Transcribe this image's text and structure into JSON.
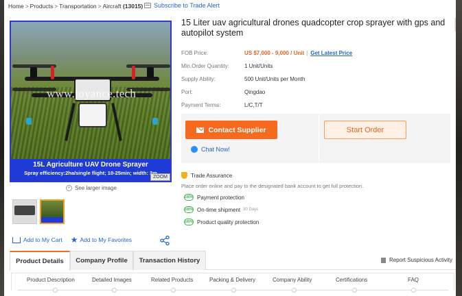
{
  "breadcrumb": {
    "items": [
      "Home",
      "Products",
      "Transportation",
      "Aircraft"
    ],
    "count": "(13015)"
  },
  "subscribe_label": "Subscribe to Trade Alert",
  "product": {
    "title": "15 Liter uav agricultural drones quadcopter crop sprayer with gps and autopilot system",
    "image_watermark": "www.joyance.tech",
    "image_caption_title": "15L Agriculture UAV Drone Sprayer",
    "image_caption_sub": "Spray efficiency:2ha/single flight; 10-25min; width: 3m",
    "zoom_label": "ZOOM",
    "see_larger": "See larger image"
  },
  "specs": {
    "fob_label": "FOB Price:",
    "fob_value": "US $7,000 - 9,000 / Unit",
    "latest_price": "Get Latest Price",
    "moq_label": "Min.Order Quantity:",
    "moq_value": "1 Unit/Units",
    "supply_label": "Supply Ability:",
    "supply_value": "500 Unit/Units per Month",
    "port_label": "Port:",
    "port_value": "Qingdao",
    "payment_label": "Payment Terms:",
    "payment_value": "L/C,T/T"
  },
  "actions": {
    "contact": "Contact Supplier",
    "order": "Start Order",
    "chat": "Chat Now!"
  },
  "trade": {
    "title": "Trade Assurance",
    "desc": "Place order online and pay to the designated bank account to get full protection.",
    "badge": "100%",
    "items": [
      "Payment protection",
      "On-time shipment",
      "Product quality protection"
    ],
    "shipment_days": "30 Days"
  },
  "cart": {
    "add_cart": "Add to My Cart",
    "add_fav": "Add to My Favorites"
  },
  "tabs": [
    "Product Details",
    "Company Profile",
    "Transaction History"
  ],
  "report": "Report Suspicious Activity",
  "subnav": [
    "Product Description",
    "Detailed Images",
    "Related Products",
    "Packing & Delivery",
    "Company Ability",
    "Certifications",
    "FAQ"
  ],
  "colors": {
    "accent_orange": "#f56a1e",
    "link_blue": "#2266cc",
    "caption_blue": "#1f3ad6",
    "trade_green": "#3bb24a"
  }
}
